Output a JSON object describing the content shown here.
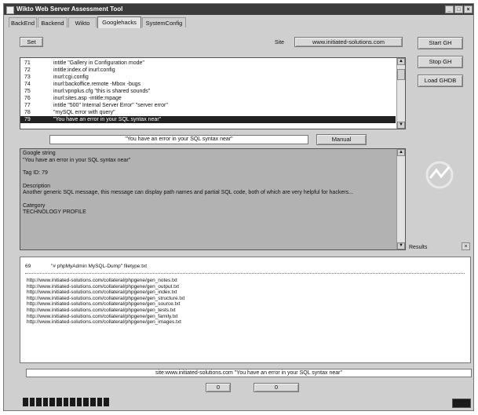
{
  "window": {
    "title": "Wikto Web Server Assessment Tool"
  },
  "window_buttons": {
    "minimize": "_",
    "maximize": "□",
    "close": "×"
  },
  "tabs": [
    "BackEnd",
    "Backend",
    "Wikto",
    "Googlehacks",
    "SystemConfig"
  ],
  "active_tab": "Googlehacks",
  "toolbar": {
    "top_left_button": "Set",
    "small_label": "Site",
    "site_button": "www.initiated-solutions.com",
    "start_button": "Start GH",
    "stop_button": "Stop GH",
    "load_button": "Load GHDB"
  },
  "gh_list": [
    {
      "num": "71",
      "text": "intitle \"Gallery in Configuration mode\""
    },
    {
      "num": "72",
      "text": "intitle:index.of inurl:config"
    },
    {
      "num": "73",
      "text": "inurl:cgi.config"
    },
    {
      "num": "74",
      "text": "inurl:backoffice.remote -Mbox -bugs"
    },
    {
      "num": "75",
      "text": "inurl:vpnplus.cfg \"this is shared sounds\""
    },
    {
      "num": "76",
      "text": "inurl:sites.asp -intitle:mpage"
    },
    {
      "num": "77",
      "text": "intitle \"500\" Internal Server Error\" \"server error\""
    },
    {
      "num": "78",
      "text": "\"mySQL error with query\""
    },
    {
      "num": "79",
      "text": "\"You have an error in your SQL syntax near\""
    }
  ],
  "selected_row": 8,
  "query_field": "\"You have an error in your SQL syntax near\"",
  "manual_button": "Manual",
  "description": {
    "label": "Google string",
    "query": "\"You have an error in your SQL syntax near\"",
    "id": "Tag ID: 79",
    "desc_label": "Description",
    "desc_text": "Another generic SQL message, this message can display path names and partial SQL code, both of which are very helpful for hackers...",
    "category_label": "Category",
    "category_value": "TECHNOLOGY PROFILE"
  },
  "results_label": "Results",
  "results": {
    "num": "69",
    "query": "\"# phpMyAdmin MySQL-Dump\" filetype:txt",
    "links": [
      "http://www.initiated-solutions.com/collateral/phpgene/gen_notes.txt",
      "http://www.initiated-solutions.com/collateral/phpgene/gen_output.txt",
      "http://www.initiated-solutions.com/collateral/phpgene/gen_index.txt",
      "http://www.initiated-solutions.com/collateral/phpgene/gen_structure.txt",
      "http://www.initiated-solutions.com/collateral/phpgene/gen_source.txt",
      "http://www.initiated-solutions.com/collateral/phpgene/gen_tests.txt",
      "http://www.initiated-solutions.com/collateral/phpgene/gen_family.txt",
      "http://www.initiated-solutions.com/collateral/phpgene/gen_images.txt"
    ]
  },
  "status_bar": "site:www.initiated-solutions.com \"You have an error in your SQL syntax near\"",
  "counters": {
    "left": "0",
    "right": "0"
  },
  "progress": {
    "segments": 13,
    "level": 1.0
  },
  "colors": {
    "selection": "#222222",
    "titlebar": "#3a3a3a",
    "description_bg": "#b2b2b2"
  }
}
